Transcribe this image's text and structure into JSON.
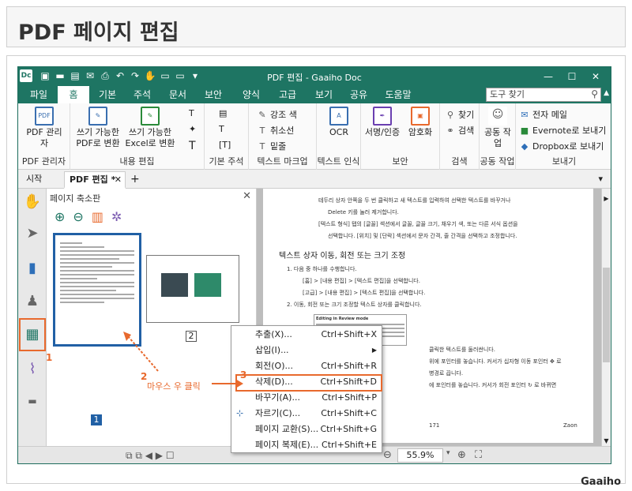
{
  "page_title": "PDF 페이지 편집",
  "app": {
    "icon": "Dc",
    "title": "PDF 편집 - Gaaiho Doc",
    "window_buttons": [
      "minimize-icon",
      "maximize-icon",
      "close-icon"
    ],
    "menu_tabs": [
      "파일",
      "홈",
      "기본",
      "주석",
      "문서",
      "보안",
      "양식",
      "고급",
      "보기",
      "공유",
      "도움말"
    ],
    "active_tab": "홈",
    "search_placeholder": "도구 찾기",
    "ribbon": {
      "pdf_manager": {
        "label": "PDF 관리자",
        "group": "PDF 관리자"
      },
      "content_edit": {
        "btn1": "쓰기 가능한 PDF로 변환",
        "btn2": "쓰기 가능한 Excel로 변환",
        "group": "내용 편집"
      },
      "basic_annot": {
        "group": "기본 주석"
      },
      "text_markup": {
        "items": [
          "강조 색",
          "취소선",
          "밑줄"
        ],
        "group": "텍스트 마크업"
      },
      "text_recog": {
        "label": "OCR",
        "group": "텍스트 인식"
      },
      "security": {
        "btn1": "서명/인증",
        "btn2": "암호화",
        "group": "보안"
      },
      "search": {
        "items": [
          "찾기",
          "검색"
        ],
        "group": "검색"
      },
      "collab": {
        "label": "공동 작업",
        "group": "공동 작업"
      },
      "send": {
        "items": [
          "전자 메일",
          "Evernote로 보내기",
          "Dropbox로 보내기"
        ],
        "group": "보내기"
      }
    },
    "doc_tabs": {
      "start": "시작",
      "active": "PDF 편집 *"
    },
    "thumb_panel": {
      "title": "페이지 축소판",
      "pages": [
        "1",
        "2"
      ]
    },
    "document": {
      "line1": "테두리 상자 안쪽을 두 번 클릭하고 새 텍스트를 입력하여 선택한 텍스트를 바꾸거나",
      "line1b": "Delete 키를 눌러 제거합니다.",
      "line2": "[텍스트 형식] 탭의 [글꼴] 섹션에서 글꼴, 글꼴 크기, 채우기 색, 또는 다른 서식 옵션을",
      "line2b": "선택합니다. [위치] 및 [단락] 섹션에서 문자 간격, 줄 간격을 선택하고 조정합니다.",
      "heading": "텍스트 상자 이동, 회전 또는 크기 조정",
      "step1": "1.  다음 중 하나를 수행합니다.",
      "step1a": "[홈] > [내용 편집] > [텍스트 편집]을 선택합니다.",
      "step1b": "[고급] > [내용 편집] > [텍스트 편집]을 선택합니다.",
      "step2": "2.  이동, 회전 또는 크기 조정할 텍스트 상자를 클릭합니다.",
      "embedded_heading": "Editing in Review mode",
      "frag1": "클릭한 텍스트를 둘러싼니다.",
      "frag2": "위에 포인터를 놓습니다. 커서가 십자형 이동 포인터 ✥ 로",
      "frag3": "병경로 끕니다.",
      "frag4": "에 포인터를 놓습니다. 커서가 회전 포인터 ↻ 로 바뀌면",
      "page_no": "171",
      "footer": "Zaon"
    },
    "zoom": "55.9%"
  },
  "context_menu": [
    {
      "label": "추출(X)...",
      "shortcut": "Ctrl+Shift+X"
    },
    {
      "label": "삽입(I)...",
      "shortcut": "▶"
    },
    {
      "label": "회전(O)...",
      "shortcut": "Ctrl+Shift+R"
    },
    {
      "label": "삭제(D)...",
      "shortcut": "Ctrl+Shift+D"
    },
    {
      "label": "바꾸기(A)...",
      "shortcut": "Ctrl+Shift+P"
    },
    {
      "label": "자르기(C)...",
      "shortcut": "Ctrl+Shift+C"
    },
    {
      "label": "페이지 교환(S)...",
      "shortcut": "Ctrl+Shift+G"
    },
    {
      "label": "페이지 복제(E)...",
      "shortcut": "Ctrl+Shift+E"
    }
  ],
  "callouts": {
    "n1": "1",
    "n2": "2",
    "n3": "3",
    "right_click": "마우스 우 클릭"
  },
  "brand": "Gaaiho",
  "colors": {
    "accent": "#1e7563",
    "callout": "#e8692d",
    "selection": "#2160a5"
  }
}
